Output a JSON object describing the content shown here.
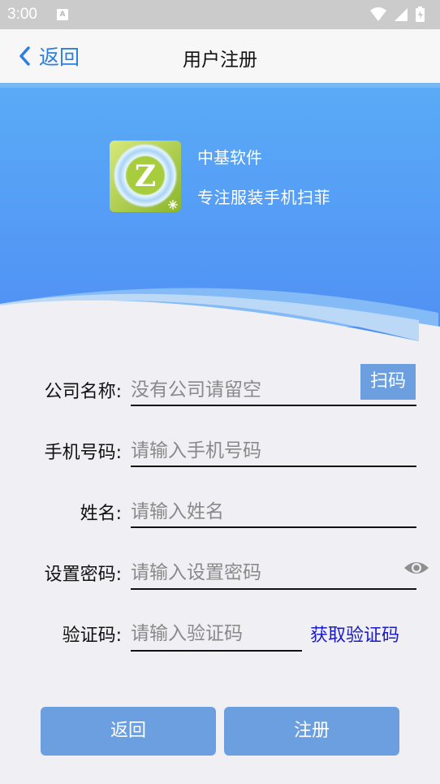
{
  "status_bar": {
    "time": "3:00",
    "notification_icon": "A",
    "icons": [
      "wifi-icon",
      "signal-icon",
      "battery-charging-icon"
    ]
  },
  "nav": {
    "back_label": "返回",
    "title": "用户注册"
  },
  "banner": {
    "logo_letter": "Z",
    "brand_name": "中基软件",
    "slogan": "专注服装手机扫菲",
    "colors": {
      "top": "#5aabf7",
      "bottom": "#5291f4",
      "wave_light": "#bcd8f7",
      "wave_mid": "#84bbf6"
    }
  },
  "form": {
    "company": {
      "label": "公司名称:",
      "placeholder": "没有公司请留空",
      "value": "",
      "scan_label": "扫码"
    },
    "phone": {
      "label": "手机号码:",
      "placeholder": "请输入手机号码",
      "value": ""
    },
    "name": {
      "label": "姓名:",
      "placeholder": "请输入姓名",
      "value": ""
    },
    "password": {
      "label": "设置密码:",
      "placeholder": "请输入设置密码",
      "value": ""
    },
    "code": {
      "label": "验证码:",
      "placeholder": "请输入验证码",
      "value": "",
      "get_code_label": "获取验证码"
    }
  },
  "actions": {
    "back_label": "返回",
    "register_label": "注册"
  },
  "colors": {
    "accent": "#2b7fe0",
    "button": "#6b9fe0",
    "link": "#1a1ad0",
    "background": "#efeff4"
  }
}
